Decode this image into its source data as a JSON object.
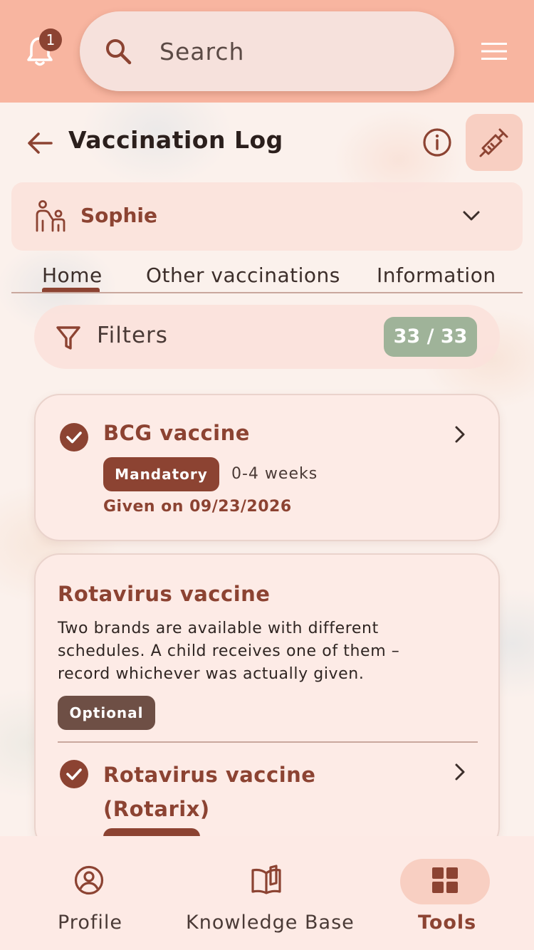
{
  "topbar": {
    "notification_count": "1",
    "search_placeholder": "Search"
  },
  "header": {
    "title": "Vaccination Log"
  },
  "child_selector": {
    "name": "Sophie"
  },
  "tabs": [
    {
      "label": "Home",
      "active": true
    },
    {
      "label": "Other vaccinations",
      "active": false
    },
    {
      "label": "Information",
      "active": false
    }
  ],
  "filters": {
    "label": "Filters",
    "count": "33 / 33"
  },
  "vaccines": [
    {
      "title": "BCG vaccine",
      "status": "given",
      "tag": "Mandatory",
      "age": "0-4 weeks",
      "given": "Given on 09/23/2026"
    },
    {
      "title": "Rotavirus vaccine",
      "description": "Two brands are available with different schedules. A child receives one of them – record whichever was actually given.",
      "tag": "Optional",
      "sub_items": [
        {
          "title": "Rotavirus vaccine (Rotarix)",
          "status": "given"
        }
      ]
    }
  ],
  "bottom_nav": [
    {
      "label": "Profile",
      "icon": "profile-icon",
      "active": false
    },
    {
      "label": "Knowledge Base",
      "icon": "book-icon",
      "active": false
    },
    {
      "label": "Tools",
      "icon": "grid-icon",
      "active": true
    }
  ],
  "colors": {
    "topbar": "#f8b5a0",
    "accent": "#8c4332",
    "badge_green": "#9fb399",
    "card": "#fdebe6"
  }
}
